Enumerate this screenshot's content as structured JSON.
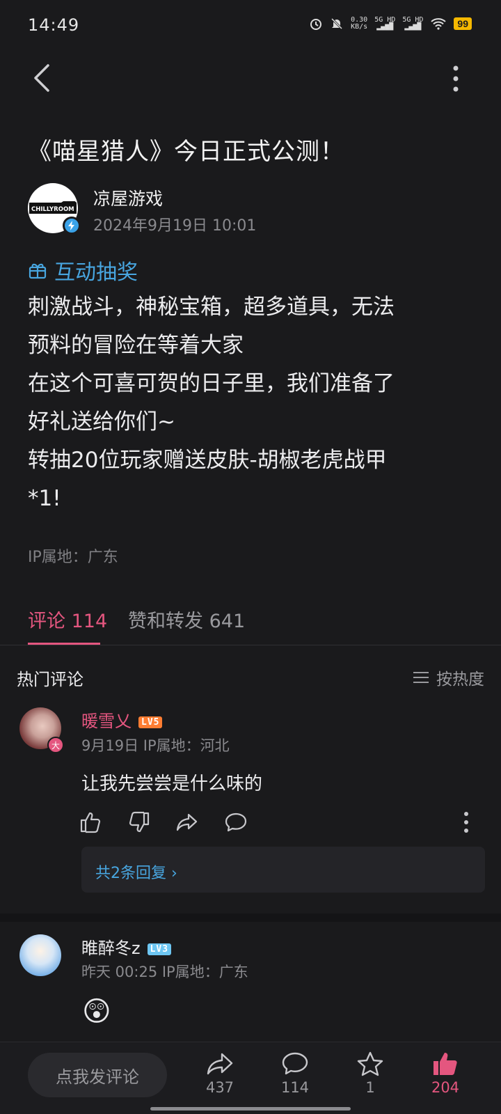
{
  "status_bar": {
    "time": "14:49",
    "net_speed": "0.30",
    "net_unit": "KB/s",
    "sig1": "5G HD",
    "sig2": "5G HD",
    "battery": "99"
  },
  "post": {
    "title": "《喵星猎人》今日正式公测！",
    "author": {
      "name": "凉屋游戏",
      "time": "2024年9月19日 10:01",
      "logo_text": "CHILLYROOM"
    },
    "tag": "互动抽奖",
    "body_lines": [
      "刺激战斗，神秘宝箱，超多道具，无法",
      "预料的冒险在等着大家",
      "在这个可喜可贺的日子里，我们准备了",
      "好礼送给你们~",
      "转抽20位玩家赠送皮肤-胡椒老虎战甲",
      "*1!"
    ],
    "ip": "IP属地：广东"
  },
  "tabs": {
    "comments": "评论 114",
    "likes_shares": "赞和转发 641"
  },
  "comments_section": {
    "header": "热门评论",
    "sort": "按热度"
  },
  "comments": [
    {
      "name": "暖雪乂",
      "level": "LV5",
      "badge": "大",
      "meta": "9月19日  IP属地：河北",
      "text": "让我先尝尝是什么味的",
      "replies": "共2条回复 ›"
    },
    {
      "name": "睢醉冬z",
      "level": "LV3",
      "meta": "昨天 00:25  IP属地：广东",
      "text": "😲"
    }
  ],
  "bottom_bar": {
    "input_placeholder": "点我发评论",
    "share_count": "437",
    "comment_count": "114",
    "favorite_count": "1",
    "like_count": "204"
  },
  "colors": {
    "accent": "#e4567f",
    "link": "#48a6e0",
    "background": "#1a1a1c"
  }
}
